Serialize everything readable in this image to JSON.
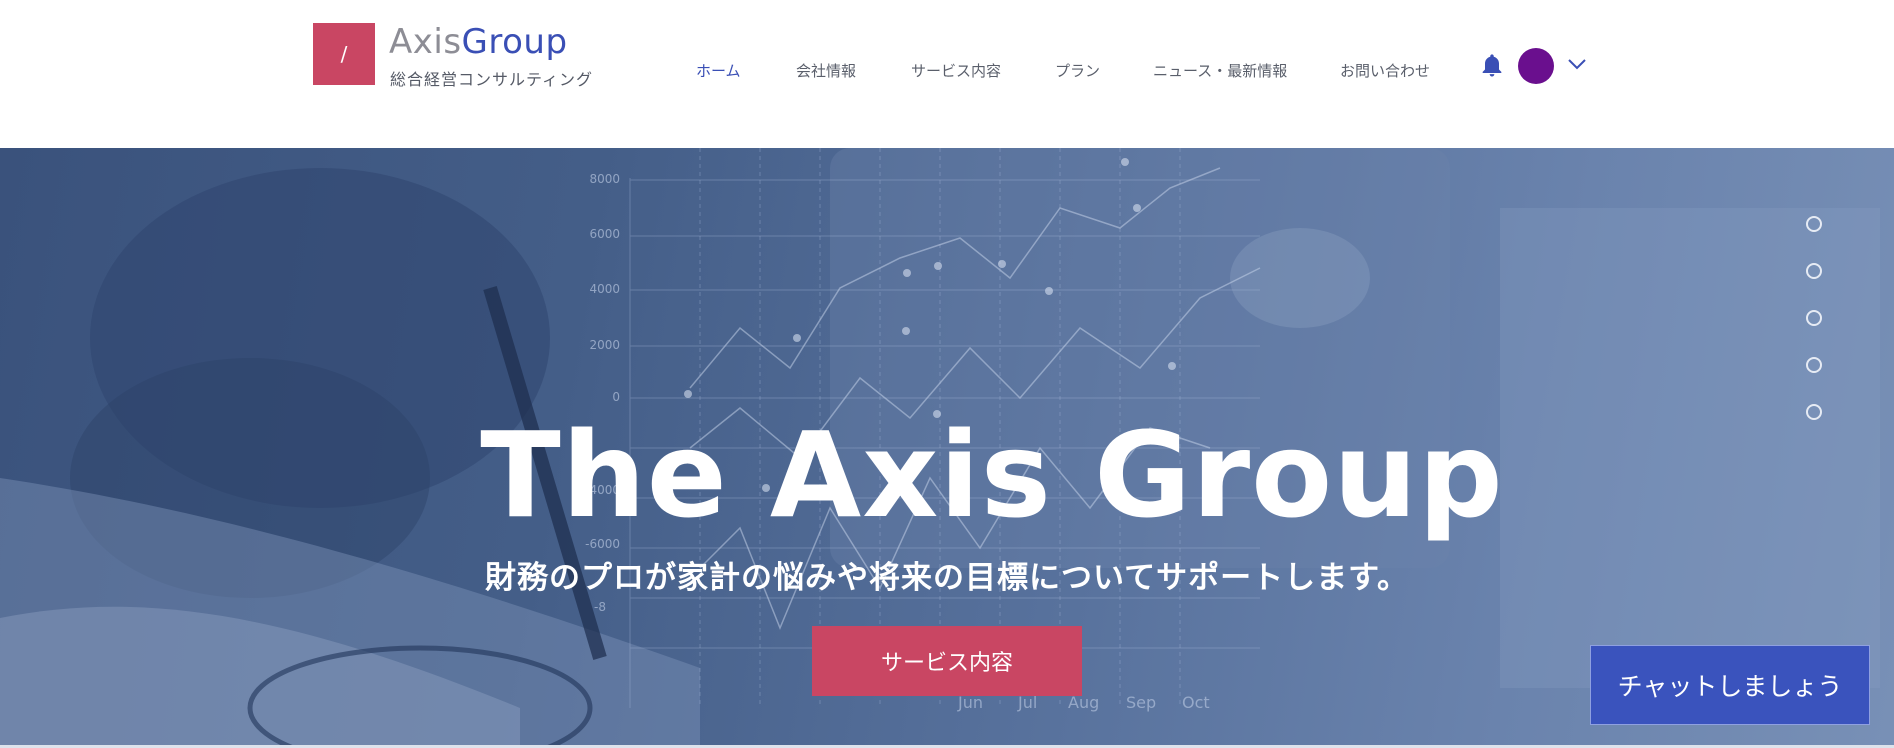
{
  "header": {
    "logo_mark": "/",
    "brand_part1": "Axis",
    "brand_part2": "Group",
    "tagline": "総合経営コンサルティング",
    "nav": [
      {
        "label": "ホーム",
        "active": true
      },
      {
        "label": "会社情報",
        "active": false
      },
      {
        "label": "サービス内容",
        "active": false
      },
      {
        "label": "プラン",
        "active": false
      },
      {
        "label": "ニュース・最新情報",
        "active": false
      },
      {
        "label": "お問い合わせ",
        "active": false
      }
    ],
    "icons": {
      "bell": "bell-icon",
      "avatar": "avatar",
      "menu": "chevron-down-icon"
    },
    "colors": {
      "accent": "#3a4fb5",
      "avatar": "#6a0f8e",
      "logo": "#c94663"
    }
  },
  "hero": {
    "title": "The Axis Group",
    "subtitle": "財務のプロが家計の悩みや将来の目標についてサポートします。",
    "button_label": "サービス内容",
    "slide_count": 5,
    "background_chart": {
      "y_ticks": [
        "8000",
        "6000",
        "4000",
        "2000",
        "0",
        "-4000",
        "-6000",
        "-8"
      ],
      "x_ticks": [
        "Jun",
        "Jul",
        "Aug",
        "Sep",
        "Oct"
      ]
    }
  },
  "chat": {
    "label": "チャットしましょう"
  }
}
